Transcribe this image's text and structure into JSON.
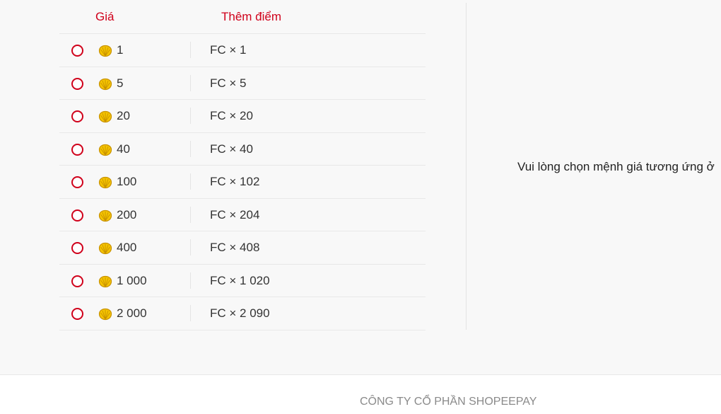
{
  "table": {
    "header_price": "Giá",
    "header_points": "Thêm điểm",
    "rows": [
      {
        "price": "1",
        "points": "FC × 1"
      },
      {
        "price": "5",
        "points": "FC × 5"
      },
      {
        "price": "20",
        "points": "FC × 20"
      },
      {
        "price": "40",
        "points": "FC × 40"
      },
      {
        "price": "100",
        "points": "FC × 102"
      },
      {
        "price": "200",
        "points": "FC × 204"
      },
      {
        "price": "400",
        "points": "FC × 408"
      },
      {
        "price": "1 000",
        "points": "FC × 1 020"
      },
      {
        "price": "2 000",
        "points": "FC × 2 090"
      }
    ]
  },
  "right_panel": {
    "message": "Vui lòng chọn mệnh giá tương ứng ở"
  },
  "footer": {
    "company": "CÔNG TY CỔ PHẦN SHOPEEPAY"
  },
  "icons": {
    "coin": "shell-coin-icon"
  },
  "colors": {
    "accent": "#d0011b",
    "coin": "#f5c400"
  }
}
